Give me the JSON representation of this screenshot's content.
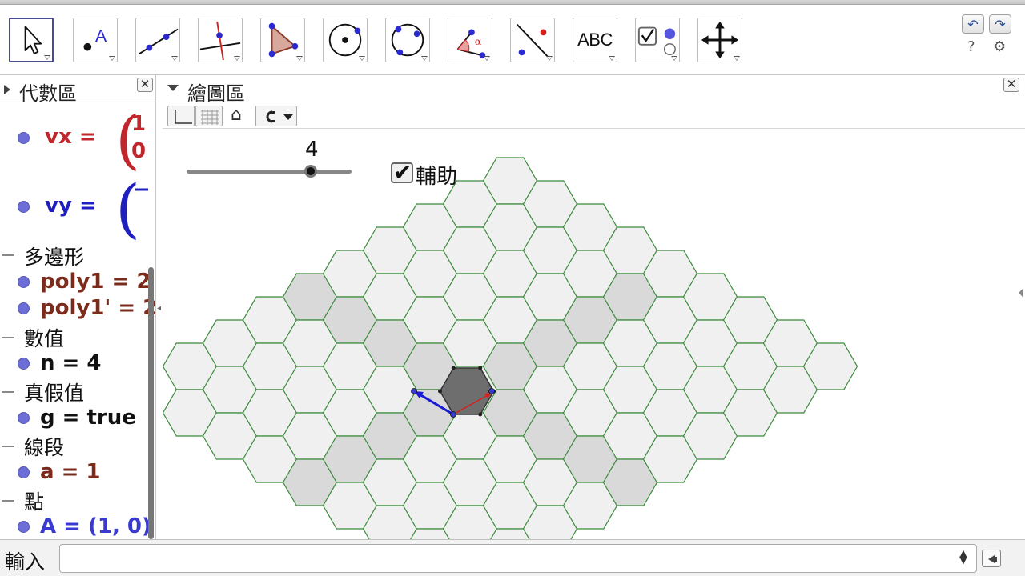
{
  "toolbar": {
    "tools": [
      {
        "name": "move-tool",
        "icon": "arrow-pointer-icon",
        "selected": true
      },
      {
        "name": "point-tool",
        "icon": "point-icon",
        "label": "A"
      },
      {
        "name": "line-tool",
        "icon": "line-through-points-icon"
      },
      {
        "name": "perpendicular-line-tool",
        "icon": "perpendicular-line-icon"
      },
      {
        "name": "polygon-tool",
        "icon": "polygon-icon"
      },
      {
        "name": "circle-center-point-tool",
        "icon": "circle-center-icon"
      },
      {
        "name": "circle-three-points-tool",
        "icon": "circle-three-points-icon"
      },
      {
        "name": "angle-tool",
        "icon": "angle-icon",
        "label": "α"
      },
      {
        "name": "reflect-tool",
        "icon": "reflect-line-icon"
      },
      {
        "name": "text-tool",
        "icon": "text-icon",
        "label": "ABC"
      },
      {
        "name": "checkbox-tool",
        "icon": "checkbox-radio-icon"
      },
      {
        "name": "move-graphics-tool",
        "icon": "move-cross-arrows-icon"
      }
    ],
    "undo_icon": "↶",
    "redo_icon": "↷",
    "help_icon": "?",
    "settings_icon": "⚙"
  },
  "algebra": {
    "title": "代數區",
    "close": "✕",
    "vx_label": "vx =",
    "vx_top": "1",
    "vx_bottom": "0",
    "vy_label": "vy =",
    "vy_top": "−",
    "groups": [
      {
        "label": "多邊形",
        "items": [
          {
            "text": "poly1 = 2",
            "color": "#7a2b1c"
          },
          {
            "text": "poly1' = 2",
            "color": "#7a2b1c"
          }
        ]
      },
      {
        "label": "數值",
        "items": [
          {
            "text": "n = 4",
            "color": "#111111"
          }
        ]
      },
      {
        "label": "真假值",
        "items": [
          {
            "text": "g = true",
            "color": "#111111"
          }
        ]
      },
      {
        "label": "線段",
        "items": [
          {
            "text": "a = 1",
            "color": "#7a2b1c"
          }
        ]
      },
      {
        "label": "點",
        "items": [
          {
            "text": "A = (1, 0)",
            "color": "#3a3ad0"
          }
        ]
      }
    ]
  },
  "graphics": {
    "title": "繪圖區",
    "close": "✕",
    "home_icon": "⌂",
    "slider_value": "4",
    "slider_fraction": 0.77,
    "checkbox_label": "輔助",
    "checkbox_checked": true,
    "checkmark": "✔"
  },
  "input": {
    "label": "輸入",
    "value": "",
    "updown": "▲▼"
  },
  "colors": {
    "hex_edge": "#3a8a3a",
    "hex_fill": "#f0f0f0",
    "hex_shade": "#d9d9d9",
    "hex_center": "#6e6e6e",
    "vector_blue": "#1a1ad6",
    "vector_red": "#d62020",
    "vx_color": "#c0262c",
    "vy_color": "#1f1fbf",
    "point_color": "#3a3ad0"
  }
}
